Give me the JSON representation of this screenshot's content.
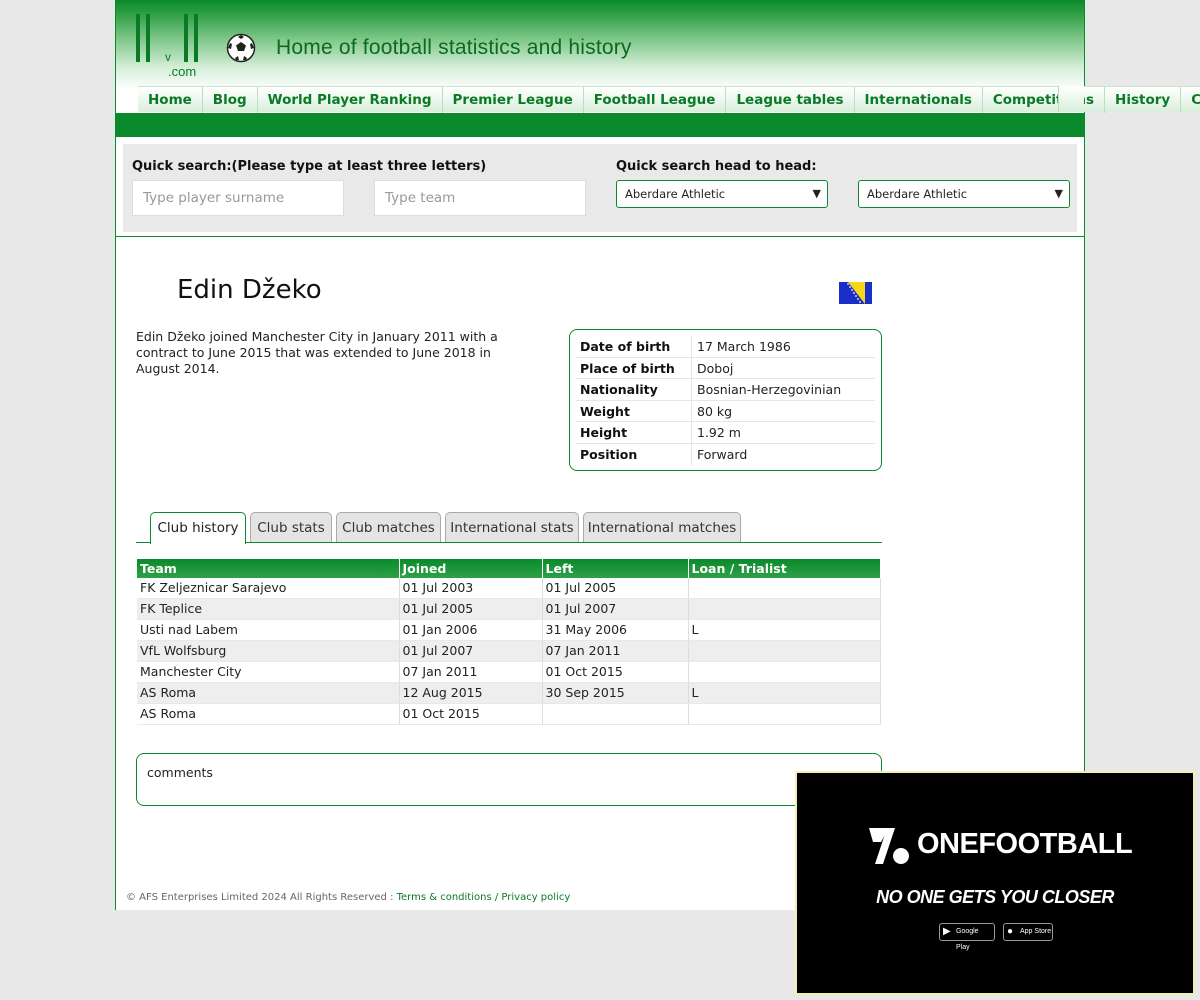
{
  "header": {
    "logo_v": "v",
    "logo_com": ".com",
    "tagline": "Home of football statistics and history"
  },
  "nav": {
    "items": [
      "Home",
      "Blog",
      "World Player Ranking",
      "Premier League",
      "Football League",
      "League tables",
      "Internationals",
      "Competitions",
      "History",
      "Contact"
    ]
  },
  "quick_search": {
    "label": "Quick search:(Please type at least three letters)",
    "player_placeholder": "Type player surname",
    "team_placeholder": "Type team",
    "h2h_label": "Quick search head to head:",
    "team1_selected": "Aberdare Athletic",
    "team2_selected": "Aberdare Athletic"
  },
  "player": {
    "name": "Edin Džeko",
    "bio": "Edin Džeko joined Manchester City in January 2011 with a contract to June 2015 that was extended to June 2018 in August 2014.",
    "info": [
      {
        "key": "Date of birth",
        "value": "17 March 1986"
      },
      {
        "key": "Place of birth",
        "value": "Doboj"
      },
      {
        "key": "Nationality",
        "value": "Bosnian-Herzegovinian"
      },
      {
        "key": "Weight",
        "value": "80 kg"
      },
      {
        "key": "Height",
        "value": "1.92 m"
      },
      {
        "key": "Position",
        "value": "Forward"
      }
    ]
  },
  "tabs": [
    "Club history",
    "Club stats",
    "Club matches",
    "International stats",
    "International matches"
  ],
  "history": {
    "headers": [
      "Team",
      "Joined",
      "Left",
      "Loan / Trialist"
    ],
    "rows": [
      [
        "FK Zeljeznicar Sarajevo",
        "01 Jul 2003",
        "01 Jul 2005",
        ""
      ],
      [
        "FK Teplice",
        "01 Jul 2005",
        "01 Jul 2007",
        ""
      ],
      [
        "Usti nad Labem",
        "01 Jan 2006",
        "31 May 2006",
        "L"
      ],
      [
        "VfL Wolfsburg",
        "01 Jul 2007",
        "07 Jan 2011",
        ""
      ],
      [
        "Manchester City",
        "07 Jan 2011",
        "01 Oct 2015",
        ""
      ],
      [
        "AS Roma",
        "12 Aug 2015",
        "30 Sep 2015",
        "L"
      ],
      [
        "AS Roma",
        "01 Oct 2015",
        "",
        ""
      ]
    ]
  },
  "comments_label": "comments",
  "footer": {
    "copyright": "© AFS Enterprises Limited 2024 All Rights Reserved : ",
    "terms": "Terms & conditions",
    "sep": " / ",
    "privacy": "Privacy policy"
  },
  "ad": {
    "brand": "ONEFOOTBALL",
    "slogan": "NO ONE GETS YOU CLOSER",
    "google_play": "Google Play",
    "app_store": "App Store"
  },
  "colors": {
    "brand_green": "#0a8a2a",
    "ad_bg": "#000000"
  }
}
